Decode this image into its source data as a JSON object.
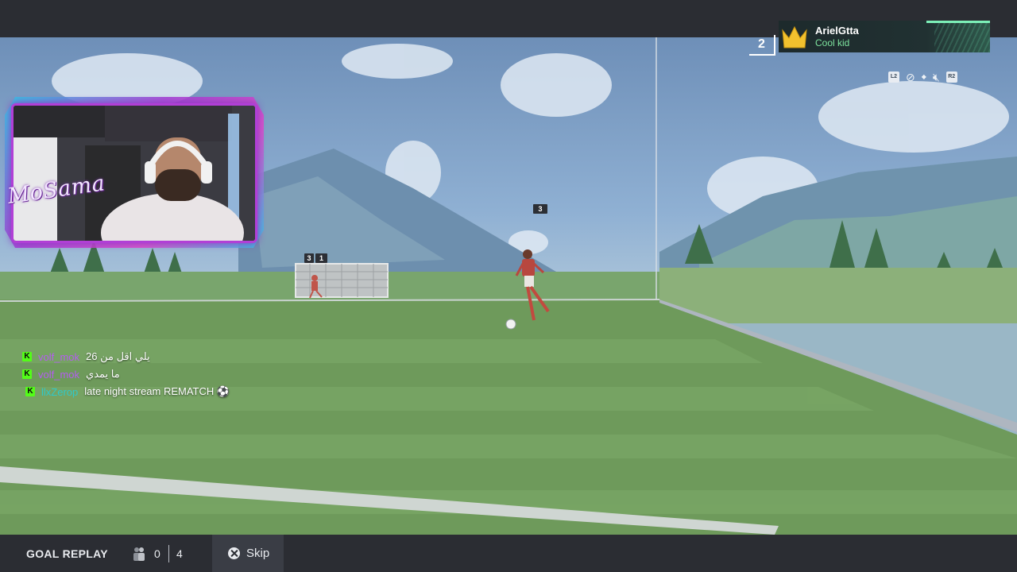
{
  "webcam": {
    "streamer_name": "MoSama"
  },
  "player_card": {
    "rank": "2",
    "name": "ArielGtta",
    "title": "Cool kid",
    "crown_color": "#f2c12e"
  },
  "hud": {
    "buttons": [
      "L2",
      "R2"
    ],
    "icons": [
      "camera-off-icon",
      "dot-icon",
      "mute-icon"
    ]
  },
  "markers": {
    "near_ball": "3",
    "goal_left": "3",
    "goal_right": "1"
  },
  "chat": [
    {
      "badge": "K",
      "user": "volf_mok",
      "user_color": "#b45cf0",
      "message": "يلي اقل من 26"
    },
    {
      "badge": "K",
      "user": "volf_mok",
      "user_color": "#b45cf0",
      "message": "ما يمدي"
    },
    {
      "badge": "K",
      "user": "llxZerop",
      "user_color": "#2fc9c9",
      "message": "late night stream REMATCH ⚽"
    }
  ],
  "bottom_bar": {
    "mode_label": "GOAL REPLAY",
    "score_home": "0",
    "score_away": "4",
    "skip_label": "Skip",
    "skip_button_icon": "cross-button-icon"
  },
  "colors": {
    "kick_badge": "#53fc18",
    "webcam_border": "#b13fd6",
    "player_title": "#7de39e"
  }
}
